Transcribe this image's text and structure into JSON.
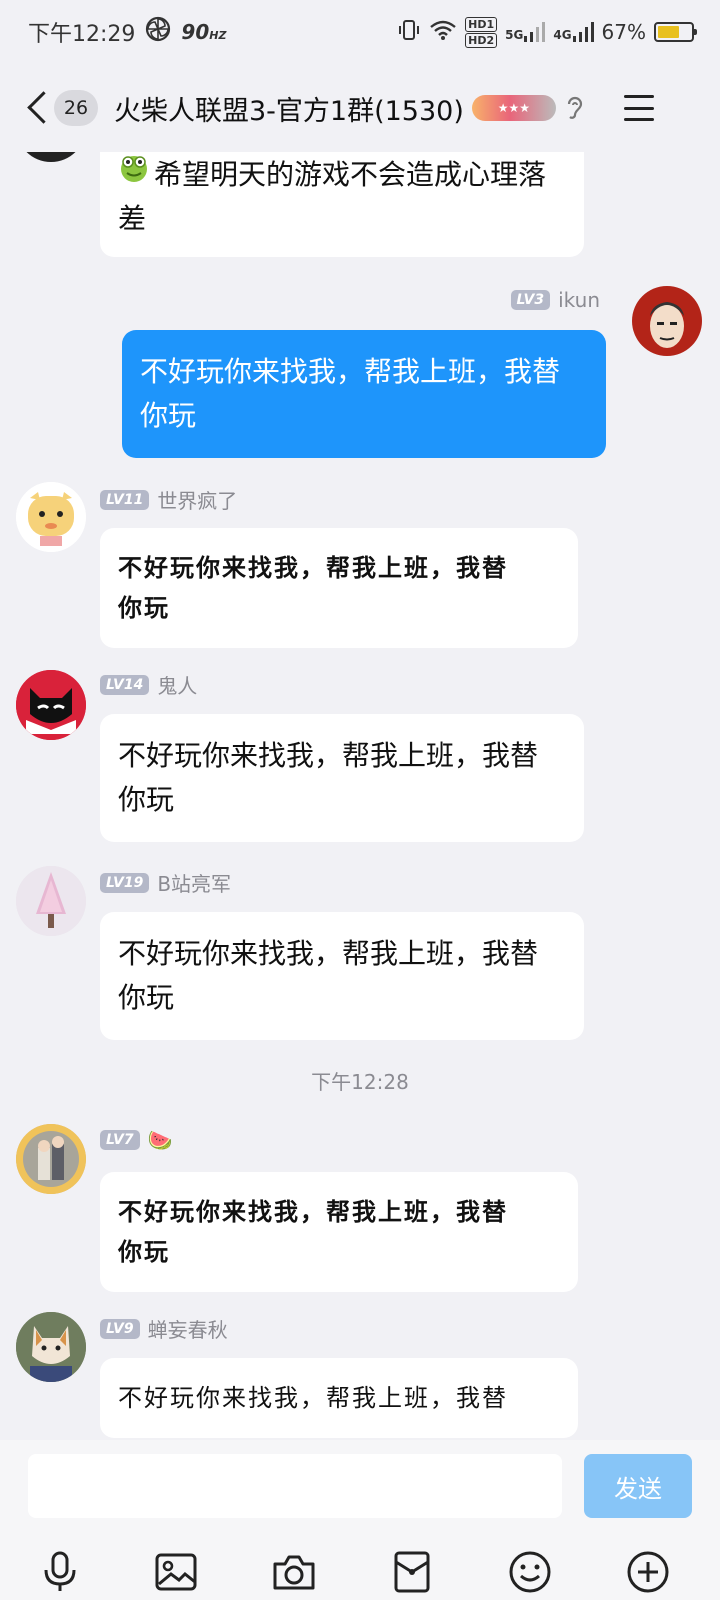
{
  "status_bar": {
    "time": "下午12:29",
    "refresh_rate": "90",
    "refresh_unit": "HZ",
    "hd1": "HD1",
    "hd2": "HD2",
    "net1": "5G",
    "net2": "4G",
    "battery": "67%",
    "battery_level": 0.67
  },
  "header": {
    "unread_count": "26",
    "title": "火柴人联盟3-官方1群(1530)"
  },
  "messages": [
    {
      "text_line1": "希望明天的游戏不会造成心理落",
      "text_line2": "差"
    },
    {
      "level": "LV3",
      "name": "ikun",
      "text_line1": "不好玩你来找我，帮我上班，我替",
      "text_line2": "你玩"
    },
    {
      "level": "LV11",
      "name": "世界疯了",
      "text_line1": "不好玩你来找我，帮我上班，我替",
      "text_line2": "你玩"
    },
    {
      "level": "LV14",
      "name": "鬼人",
      "text_line1": "不好玩你来找我，帮我上班，我替",
      "text_line2": "你玩"
    },
    {
      "level": "LV19",
      "name": "B站亮军",
      "text_line1": "不好玩你来找我，帮我上班，我替",
      "text_line2": "你玩"
    },
    {
      "level": "LV7",
      "name": "🍉",
      "text_line1": "不好玩你来找我，帮我上班，我替",
      "text_line2": "你玩"
    },
    {
      "level": "LV9",
      "name": "蝉妄春秋",
      "text_line1": "不好玩你来找我，帮我上班，我替",
      "text_line2": ""
    }
  ],
  "timestamp": "下午12:28",
  "input_bar": {
    "send_label": "发送"
  },
  "toolbar_icons": [
    "microphone-icon",
    "image-icon",
    "camera-icon",
    "red-packet-icon",
    "emoji-icon",
    "plus-icon"
  ],
  "colors": {
    "self_bubble": "#1e95fb",
    "send_button": "#87c5f7",
    "background": "#f1f1f5"
  }
}
